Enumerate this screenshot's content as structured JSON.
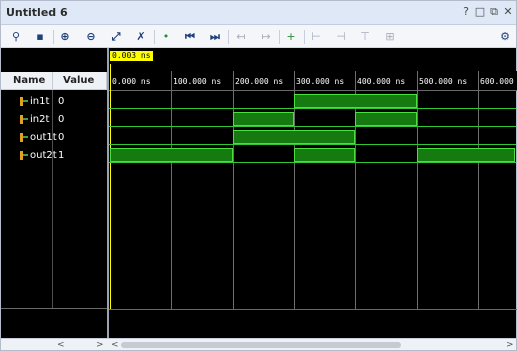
{
  "window": {
    "title": "Untitled 6"
  },
  "title_buttons": [
    {
      "name": "help-button",
      "glyph": "?"
    },
    {
      "name": "restore-button",
      "glyph": "□"
    },
    {
      "name": "maximize-button",
      "glyph": "⧉"
    },
    {
      "name": "close-button",
      "glyph": "✕"
    }
  ],
  "toolbar": [
    {
      "name": "search-icon",
      "glyph": "⚲",
      "tone": "dark"
    },
    {
      "name": "save-icon",
      "glyph": "▪",
      "tone": "dark"
    },
    {
      "name": "zoom-in-icon",
      "glyph": "⊕",
      "tone": "dark"
    },
    {
      "name": "zoom-out-icon",
      "glyph": "⊖",
      "tone": "dark"
    },
    {
      "name": "zoom-fit-icon",
      "glyph": "⤢",
      "tone": "dark"
    },
    {
      "name": "zoom-to-cursor-icon",
      "glyph": "✗",
      "tone": "dark"
    },
    {
      "name": "go-to-time-zero-icon",
      "glyph": "•",
      "tone": "green"
    },
    {
      "name": "go-to-first-icon",
      "glyph": "⏮",
      "tone": "dark"
    },
    {
      "name": "go-to-last-icon",
      "glyph": "⏭",
      "tone": "dark"
    },
    {
      "name": "previous-transition-icon",
      "glyph": "↤",
      "tone": "gray"
    },
    {
      "name": "next-transition-icon",
      "glyph": "↦",
      "tone": "gray"
    },
    {
      "name": "add-marker-icon",
      "glyph": "+",
      "tone": "green"
    },
    {
      "name": "previous-marker-icon",
      "glyph": "⊢",
      "tone": "gray"
    },
    {
      "name": "next-marker-icon",
      "glyph": "⊣",
      "tone": "gray"
    },
    {
      "name": "swap-cursors-icon",
      "glyph": "⊤",
      "tone": "gray"
    },
    {
      "name": "cursor-range-icon",
      "glyph": "⊞",
      "tone": "gray"
    },
    {
      "name": "settings-icon",
      "glyph": "⚙",
      "tone": "dark"
    }
  ],
  "columns": {
    "name": "Name",
    "value": "Value"
  },
  "signals": [
    {
      "name": "in1t",
      "value": "0"
    },
    {
      "name": "in2t",
      "value": "0"
    },
    {
      "name": "out1t",
      "value": "0"
    },
    {
      "name": "out2t",
      "value": "1"
    }
  ],
  "waveform": {
    "cursor_label": "0.003 ns",
    "cursor_time_ns": 0.003,
    "ticks": [
      "0.000 ns",
      "100.000 ns",
      "200.000 ns",
      "300.000 ns",
      "400.000 ns",
      "500.000 ns",
      "600.000"
    ],
    "tick_times_ns": [
      0,
      100,
      200,
      300,
      400,
      500,
      600
    ],
    "view_range_ns": [
      0,
      660
    ],
    "traces": [
      {
        "signal": "in1t",
        "high_intervals_ns": [
          [
            300,
            500
          ]
        ]
      },
      {
        "signal": "in2t",
        "high_intervals_ns": [
          [
            200,
            300
          ],
          [
            400,
            500
          ]
        ]
      },
      {
        "signal": "out1t",
        "high_intervals_ns": [
          [
            200,
            400
          ]
        ]
      },
      {
        "signal": "out2t",
        "high_intervals_ns": [
          [
            0,
            200
          ],
          [
            300,
            400
          ],
          [
            500,
            660
          ]
        ]
      }
    ],
    "high_color": "#157a0f",
    "edge_color": "#4dde3f",
    "cursor_color": "#ffff00"
  },
  "scroll": {
    "left": "<",
    "right": ">"
  }
}
